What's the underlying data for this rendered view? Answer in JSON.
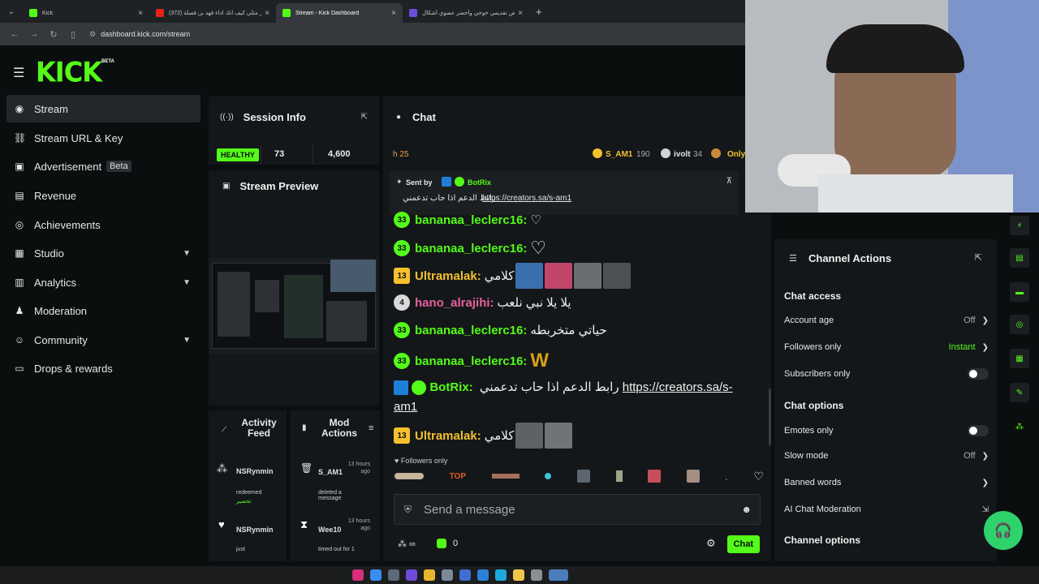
{
  "browser": {
    "tabs": [
      {
        "title": "Kick",
        "color": "#53fc18",
        "active": false
      },
      {
        "title": "(372) فكر مثلي كيف انك اداء فهد بن فصلة",
        "color": "#e62117",
        "active": false
      },
      {
        "title": "Stream - Kick Dashboard",
        "color": "#53fc18",
        "active": true
      },
      {
        "title": "عرض تقديمي خوجي وأحضر عضوي أشكال",
        "color": "#6e4bd8",
        "active": false
      }
    ],
    "url": "dashboard.kick.com/stream"
  },
  "brand": {
    "logo": "KICK",
    "beta": "BETA",
    "accent": "#53fc18"
  },
  "nav": {
    "items": [
      {
        "label": "Stream",
        "icon": "broadcast-icon"
      },
      {
        "label": "Stream URL & Key",
        "icon": "link-icon"
      },
      {
        "label": "Advertisement",
        "icon": "ad-icon",
        "badge": "Beta"
      },
      {
        "label": "Revenue",
        "icon": "revenue-icon"
      },
      {
        "label": "Achievements",
        "icon": "trophy-icon"
      },
      {
        "label": "Studio",
        "icon": "studio-icon"
      },
      {
        "label": "Analytics",
        "icon": "analytics-icon"
      },
      {
        "label": "Moderation",
        "icon": "moderation-icon"
      },
      {
        "label": "Community",
        "icon": "community-icon"
      },
      {
        "label": "Drops & rewards",
        "icon": "drops-icon"
      }
    ]
  },
  "session": {
    "title": "Session Info",
    "health": "HEALTHY",
    "stat_a": "73",
    "stat_b": "4,600"
  },
  "preview": {
    "title": "Stream Preview"
  },
  "activity": {
    "title": "Activity Feed",
    "items": [
      {
        "user": "NSRynmin",
        "text": "redeemed",
        "reward": "تحضير"
      },
      {
        "user": "NSRynmin",
        "text": "just"
      }
    ]
  },
  "mod": {
    "title": "Mod Actions",
    "items": [
      {
        "user": "S_AM1",
        "time": "13 hours ago",
        "text": "deleted a message"
      },
      {
        "user": "Wee10",
        "time": "13 hours ago",
        "text": "timed out for 1"
      }
    ]
  },
  "chat": {
    "title": "Chat",
    "topbar": {
      "left": "h 25",
      "user1": "S_AM1",
      "user1_count": "190",
      "user2": "ivolt",
      "user2_count": "34",
      "only": "Only"
    },
    "pinned": {
      "sent_by": "Sent by",
      "bot": "BotRix",
      "text": "رابط الدعم اذا حاب تدعمني",
      "link": "https://creators.sa/s-am1"
    },
    "messages": [
      {
        "badge": "33",
        "badge_type": "g",
        "user": "bananaa_leclerc16:",
        "color": "#53fc18",
        "text": "♡"
      },
      {
        "badge": "33",
        "badge_type": "g",
        "user": "bananaa_leclerc16:",
        "color": "#53fc18",
        "text": "♡"
      },
      {
        "badge": "13",
        "badge_type": "y",
        "user": "Ultramalak:",
        "color": "#f4c02c",
        "text": "كلامي"
      },
      {
        "badge": "4",
        "badge_type": "w",
        "user": "hano_alrajihi:",
        "color": "#e7609e",
        "text": "يلا يلا نبي نلعب"
      },
      {
        "badge": "33",
        "badge_type": "g",
        "user": "bananaa_leclerc16:",
        "color": "#53fc18",
        "text": "حياتي متخربطه"
      },
      {
        "badge": "33",
        "badge_type": "g",
        "user": "bananaa_leclerc16:",
        "color": "#53fc18",
        "text": "W"
      },
      {
        "badge": "",
        "badge_type": "bot",
        "user": "BotRix:",
        "color": "#53fc18",
        "text": "رابط الدعم اذا حاب تدعمني",
        "link": "https://creators.sa/s-am1"
      },
      {
        "badge": "13",
        "badge_type": "y",
        "user": "Ultramalak:",
        "color": "#f4c02c",
        "text": "كلامي"
      }
    ],
    "followers_only": "Followers only",
    "emote_top": "TOP",
    "placeholder": "Send a message",
    "points": "0",
    "send_label": "Chat"
  },
  "actions": {
    "title": "Channel Actions",
    "chat_access": "Chat access",
    "account_age": "Account age",
    "account_age_val": "Off",
    "followers_only": "Followers only",
    "followers_only_val": "Instant",
    "subscribers_only": "Subscribers only",
    "chat_options": "Chat options",
    "emotes_only": "Emotes only",
    "slow_mode": "Slow mode",
    "slow_mode_val": "Off",
    "banned_words": "Banned words",
    "ai_moderation": "AI Chat Moderation",
    "channel_options": "Channel options"
  }
}
